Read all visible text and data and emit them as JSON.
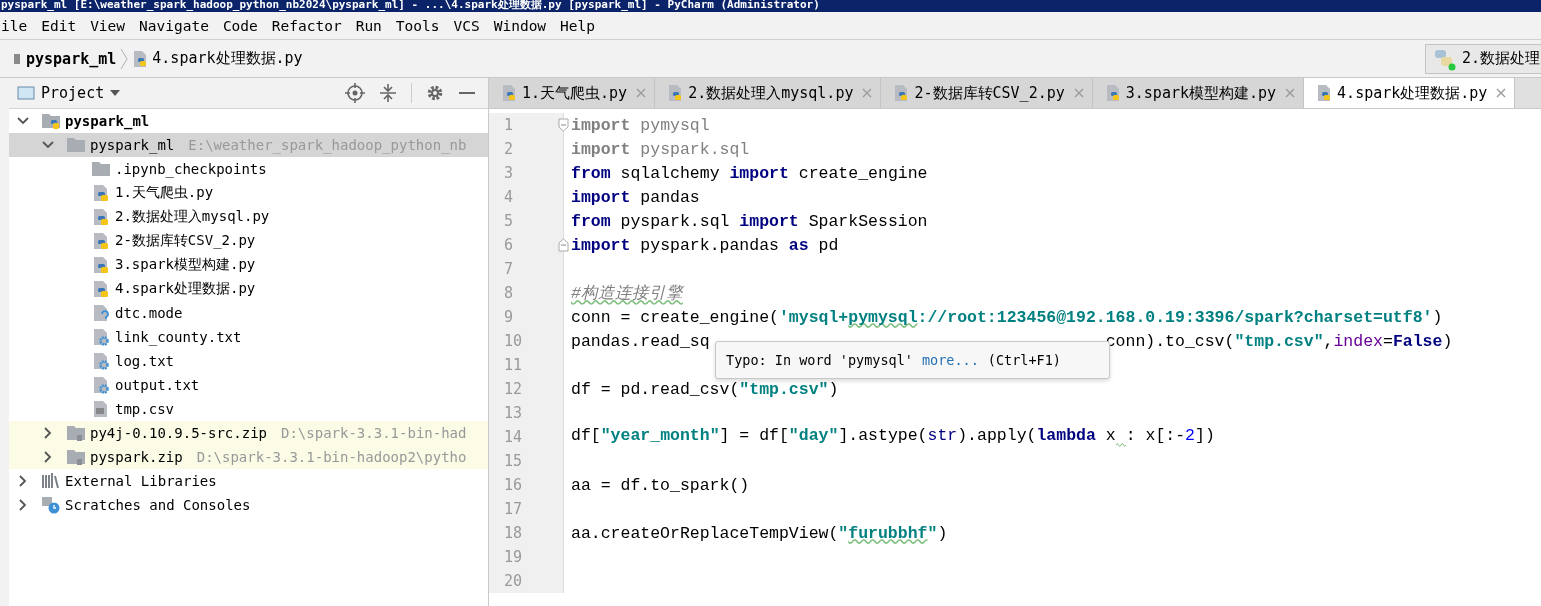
{
  "window": {
    "title": "pyspark_ml [E:\\weather_spark_hadoop_python_nb2024\\pyspark_ml] - ...\\4.spark处理数据.py [pyspark_ml] - PyCharm (Administrator)"
  },
  "menu": [
    "ile",
    "Edit",
    "View",
    "Navigate",
    "Code",
    "Refactor",
    "Run",
    "Tools",
    "VCS",
    "Window",
    "Help"
  ],
  "breadcrumbs": [
    {
      "label": "pyspark_ml",
      "kind": "project"
    },
    {
      "label": "4.spark处理数据.py",
      "kind": "py"
    }
  ],
  "run_config": {
    "label": "2.数据处理"
  },
  "project_panel": {
    "title": "Project"
  },
  "tree": [
    {
      "label": "pyspark_ml",
      "kind": "project",
      "expanded": true,
      "selected": false,
      "children": [
        {
          "label": "pyspark_ml",
          "path": "E:\\weather_spark_hadoop_python_nb",
          "kind": "folder",
          "expanded": true,
          "selected": true,
          "children": [
            {
              "label": ".ipynb_checkpoints",
              "kind": "folder",
              "selected": false
            },
            {
              "label": "1.天气爬虫.py",
              "kind": "py",
              "selected": false
            },
            {
              "label": "2.数据处理入mysql.py",
              "kind": "py",
              "selected": false
            },
            {
              "label": "2-数据库转CSV_2.py",
              "kind": "py",
              "selected": false
            },
            {
              "label": "3.spark模型构建.py",
              "kind": "py",
              "selected": false
            },
            {
              "label": "4.spark处理数据.py",
              "kind": "py",
              "selected": false
            },
            {
              "label": "dtc.mode",
              "kind": "unknown",
              "selected": false
            },
            {
              "label": "link_county.txt",
              "kind": "config",
              "selected": false
            },
            {
              "label": "log.txt",
              "kind": "config",
              "selected": false
            },
            {
              "label": "output.txt",
              "kind": "config",
              "selected": false
            },
            {
              "label": "tmp.csv",
              "kind": "csv",
              "selected": false
            }
          ]
        },
        {
          "label": "py4j-0.10.9.5-src.zip",
          "path": "D:\\spark-3.3.1-bin-had",
          "kind": "zip",
          "expanded": false,
          "selected": false
        },
        {
          "label": "pyspark.zip",
          "path": "D:\\spark-3.3.1-bin-hadoop2\\pytho",
          "kind": "zip",
          "expanded": false,
          "selected": false
        }
      ]
    },
    {
      "label": "External Libraries",
      "kind": "libraries",
      "expanded": false,
      "selected": false
    },
    {
      "label": "Scratches and Consoles",
      "kind": "scratches",
      "expanded": false,
      "selected": false
    }
  ],
  "tabs": [
    {
      "label": "1.天气爬虫.py",
      "selected": false
    },
    {
      "label": "2.数据处理入mysql.py",
      "selected": false
    },
    {
      "label": "2-数据库转CSV_2.py",
      "selected": false
    },
    {
      "label": "3.spark模型构建.py",
      "selected": false
    },
    {
      "label": "4.spark处理数据.py",
      "selected": true
    }
  ],
  "code": [
    {
      "number": "1",
      "fold_start": true,
      "tokens": [
        {
          "kind": "unused-keyword",
          "text": "import"
        },
        {
          "kind": "unused",
          "text": " pymysql"
        }
      ]
    },
    {
      "number": "2",
      "tokens": [
        {
          "kind": "unused-keyword",
          "text": "import"
        },
        {
          "kind": "unused",
          "text": " pyspark.sql"
        }
      ]
    },
    {
      "number": "3",
      "tokens": [
        {
          "kind": "keyword",
          "text": "from"
        },
        {
          "kind": "plain",
          "text": " sqlalchemy "
        },
        {
          "kind": "keyword",
          "text": "import"
        },
        {
          "kind": "plain",
          "text": " create_engine"
        }
      ]
    },
    {
      "number": "4",
      "tokens": [
        {
          "kind": "keyword",
          "text": "import"
        },
        {
          "kind": "plain",
          "text": " pandas"
        }
      ]
    },
    {
      "number": "5",
      "tokens": [
        {
          "kind": "keyword",
          "text": "from"
        },
        {
          "kind": "plain",
          "text": " pyspark.sql "
        },
        {
          "kind": "keyword",
          "text": "import"
        },
        {
          "kind": "plain",
          "text": " SparkSession"
        }
      ]
    },
    {
      "number": "6",
      "fold_end": true,
      "tokens": [
        {
          "kind": "keyword",
          "text": "import"
        },
        {
          "kind": "plain",
          "text": " pyspark.pandas "
        },
        {
          "kind": "keyword",
          "text": "as"
        },
        {
          "kind": "plain",
          "text": " pd"
        }
      ]
    },
    {
      "number": "7"
    },
    {
      "number": "8",
      "tokens": [
        {
          "kind": "comment-typo",
          "text": "#构造连接引擎"
        }
      ]
    },
    {
      "number": "9",
      "tokens": [
        {
          "kind": "plain",
          "text": "conn = create_engine("
        },
        {
          "kind": "string",
          "text": "'mysql+"
        },
        {
          "kind": "string-typo",
          "text": "pymysql"
        },
        {
          "kind": "string",
          "text": "://root:123456@192.168.0.19:3396/spark?charset=utf8'"
        },
        {
          "kind": "plain",
          "text": ")"
        }
      ]
    },
    {
      "number": "10",
      "tokens": [
        {
          "kind": "plain",
          "text": "pandas.read_sq"
        },
        {
          "kind": "covered"
        },
        {
          "kind": "plain",
          "text": "conn).to_csv("
        },
        {
          "kind": "string",
          "text": "\"tmp.csv\""
        },
        {
          "kind": "plain",
          "text": ","
        },
        {
          "kind": "param",
          "text": "index"
        },
        {
          "kind": "plain",
          "text": "="
        },
        {
          "kind": "keyword",
          "text": "False"
        },
        {
          "kind": "plain",
          "text": ")"
        }
      ]
    },
    {
      "number": "11"
    },
    {
      "number": "12",
      "tokens": [
        {
          "kind": "plain",
          "text": "df = pd.read_csv("
        },
        {
          "kind": "string",
          "text": "\"tmp.csv\""
        },
        {
          "kind": "plain",
          "text": ")"
        }
      ]
    },
    {
      "number": "13"
    },
    {
      "number": "14",
      "tokens": [
        {
          "kind": "plain",
          "text": "df["
        },
        {
          "kind": "string",
          "text": "\"year_month\""
        },
        {
          "kind": "plain",
          "text": "] = df["
        },
        {
          "kind": "string",
          "text": "\"day\""
        },
        {
          "kind": "plain",
          "text": "].astype("
        },
        {
          "kind": "builtin",
          "text": "str"
        },
        {
          "kind": "plain",
          "text": ").apply("
        },
        {
          "kind": "keyword",
          "text": "lambda"
        },
        {
          "kind": "plain",
          "text": " x"
        },
        {
          "kind": "typo-space"
        },
        {
          "kind": "plain",
          "text": ": x[:-"
        },
        {
          "kind": "number",
          "text": "2"
        },
        {
          "kind": "plain",
          "text": "])"
        }
      ]
    },
    {
      "number": "15"
    },
    {
      "number": "16",
      "tokens": [
        {
          "kind": "plain",
          "text": "aa = df.to_spark()"
        }
      ]
    },
    {
      "number": "17"
    },
    {
      "number": "18",
      "tokens": [
        {
          "kind": "plain",
          "text": "aa.createOrReplaceTempView("
        },
        {
          "kind": "string",
          "text": "\""
        },
        {
          "kind": "string-typo",
          "text": "furubbhf"
        },
        {
          "kind": "string",
          "text": "\""
        },
        {
          "kind": "plain",
          "text": ")"
        }
      ]
    },
    {
      "number": "19"
    },
    {
      "number": "20"
    }
  ],
  "tooltip": {
    "text": "Typo: In word 'pymysql'",
    "link": "more...",
    "shortcut": "(Ctrl+F1)"
  }
}
